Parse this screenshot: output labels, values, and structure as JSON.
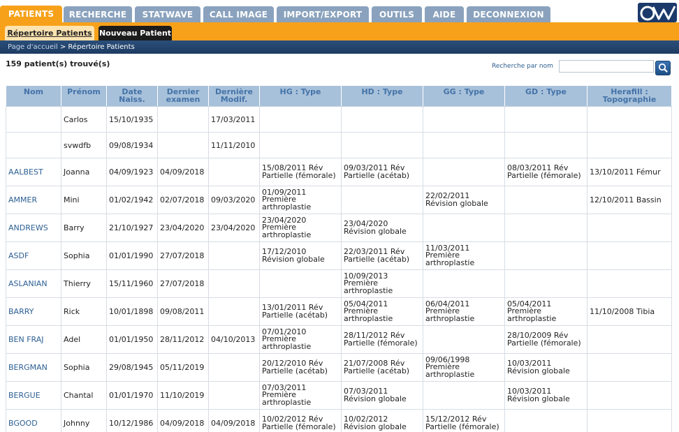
{
  "nav": {
    "tabs": [
      {
        "label": "PATIENTS",
        "active": true
      },
      {
        "label": "RECHERCHE",
        "active": false
      },
      {
        "label": "STATWAVE",
        "active": false
      },
      {
        "label": "CALL IMAGE",
        "active": false
      },
      {
        "label": "IMPORT/EXPORT",
        "active": false
      },
      {
        "label": "OUTILS",
        "active": false
      },
      {
        "label": "AIDE",
        "active": false
      },
      {
        "label": "DECONNEXION",
        "active": false
      }
    ],
    "logo_text": "OW"
  },
  "subnav": {
    "repertoire": "Répertoire Patients",
    "nouveau": "Nouveau Patient"
  },
  "breadcrumb": {
    "home": "Page d'accueil",
    "separator": ">",
    "current": "Répertoire Patients"
  },
  "results": {
    "count_text": "159 patient(s) trouvé(s)"
  },
  "search": {
    "label": "Recherche par nom",
    "value": "",
    "button_icon": "search-icon"
  },
  "table": {
    "headers": [
      "Nom",
      "Prénom",
      "Date Naiss.",
      "Dernier examen",
      "Dernière Modif.",
      "HG : Type",
      "HD : Type",
      "GG : Type",
      "GD : Type",
      "Herafill : Topographie"
    ],
    "rows": [
      [
        "",
        "Carlos",
        "15/10/1935",
        "",
        "17/03/2011",
        "",
        "",
        "",
        "",
        ""
      ],
      [
        "",
        "svwdfb",
        "09/08/1934",
        "",
        "11/11/2010",
        "",
        "",
        "",
        "",
        ""
      ],
      [
        "AALBEST",
        "Joanna",
        "04/09/1923",
        "04/09/2018",
        "",
        "15/08/2011 Rév Partielle (fémorale)",
        "09/03/2011 Rév Partielle (acétab)",
        "",
        "08/03/2011 Rév Partielle (fémorale)",
        "13/10/2011 Fémur"
      ],
      [
        "AMMER",
        "Mini",
        "01/02/1942",
        "02/07/2018",
        "09/03/2020",
        "01/09/2011 Première arthroplastie",
        "",
        "22/02/2011 Révision globale",
        "",
        "12/10/2011 Bassin"
      ],
      [
        "ANDREWS",
        "Barry",
        "21/10/1927",
        "23/04/2020",
        "23/04/2020",
        "23/04/2020 Première arthroplastie",
        "23/04/2020 Révision globale",
        "",
        "",
        ""
      ],
      [
        "ASDF",
        "Sophia",
        "01/01/1990",
        "27/07/2018",
        "",
        "17/12/2010 Révision globale",
        "22/03/2011 Rév Partielle (acétab)",
        "11/03/2011 Première arthroplastie",
        "",
        ""
      ],
      [
        "ASLANIAN",
        "Thierry",
        "15/11/1960",
        "27/07/2018",
        "",
        "",
        "10/09/2013 Première arthroplastie",
        "",
        "",
        ""
      ],
      [
        "BARRY",
        "Rick",
        "10/01/1898",
        "09/08/2011",
        "",
        "13/01/2011 Rév Partielle (acétab)",
        "05/04/2011 Première arthroplastie",
        "06/04/2011 Première arthroplastie",
        "05/04/2011 Première arthroplastie",
        "11/10/2008 Tibia"
      ],
      [
        "BEN FRAJ",
        "Adel",
        "01/01/1950",
        "28/11/2012",
        "04/10/2013",
        "07/01/2010 Première arthroplastie",
        "28/11/2012 Rév Partielle (fémorale)",
        "",
        "28/10/2009 Rév Partielle (fémorale)",
        ""
      ],
      [
        "BERGMAN",
        "Sophia",
        "29/08/1945",
        "05/11/2019",
        "",
        "20/12/2010 Rév Partielle (acétab)",
        "21/07/2008 Rév Partielle (acétab)",
        "09/06/1998 Première arthroplastie",
        "10/03/2011 Révision globale",
        ""
      ],
      [
        "BERGUE",
        "Chantal",
        "01/01/1970",
        "11/10/2019",
        "",
        "07/03/2011 Première arthroplastie",
        "07/03/2011 Révision globale",
        "",
        "10/03/2011 Révision globale",
        ""
      ],
      [
        "BGOOD",
        "Johnny",
        "10/12/1986",
        "04/09/2018",
        "04/09/2018",
        "10/02/2012 Rév Partielle (fémorale)",
        "10/02/2012 Révision globale",
        "15/12/2012 Rév Partielle (fémorale)",
        "",
        ""
      ]
    ]
  }
}
